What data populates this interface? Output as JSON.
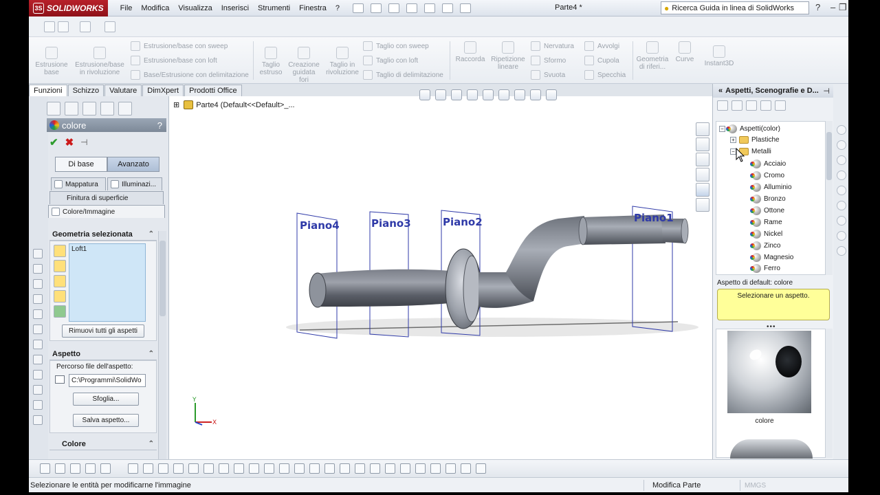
{
  "window": {
    "app_name": "SOLIDWORKS",
    "doc_title": "Parte4 *",
    "menu": [
      "File",
      "Modifica",
      "Visualizza",
      "Inserisci",
      "Strumenti",
      "Finestra",
      "?"
    ],
    "help_search_placeholder": "Ricerca Guida in linea di SolidWorks"
  },
  "ribbon": {
    "estrusione_base": "Estrusione\nbase",
    "rivoluzione_base": "Estrusione/base\nin rivoluzione",
    "sweep_base": "Estrusione/base con sweep",
    "loft_base": "Estrusione/base con loft",
    "delim_base": "Base/Estrusione con delimitazione",
    "taglio_estruso": "Taglio\nestruso",
    "creazione_guidata_fori": "Creazione\nguidata\nfori",
    "taglio_rivoluzione": "Taglio in\nrivoluzione",
    "taglio_sweep": "Taglio con sweep",
    "taglio_loft": "Taglio con loft",
    "taglio_delim": "Taglio di delimitazione",
    "raccorda": "Raccorda",
    "ripetizione_lineare": "Ripetizione\nlineare",
    "nervatura": "Nervatura",
    "sformo": "Sformo",
    "svuota": "Svuota",
    "avvolgi": "Avvolgi",
    "cupola": "Cupola",
    "specchia": "Specchia",
    "geometria_riferimento": "Geometria\ndi riferi...",
    "curve": "Curve",
    "instant3d": "Instant3D"
  },
  "cm_tabs": [
    "Funzioni",
    "Schizzo",
    "Valutare",
    "DimXpert",
    "Prodotti Office"
  ],
  "property_manager": {
    "title": "colore",
    "help": "?",
    "mode_tabs": [
      "Di base",
      "Avanzato"
    ],
    "subtabs": {
      "mappatura": "Mappatura",
      "illuminazione": "Illuminazi...",
      "finitura": "Finitura di superficie",
      "colore_immagine": "Colore/Immagine"
    },
    "geometria": {
      "header": "Geometria selezionata",
      "selected": [
        "Loft1"
      ],
      "remove_button": "Rimuovi tutti gli aspetti"
    },
    "aspetto": {
      "header": "Aspetto",
      "path_label": "Percorso file dell'aspetto:",
      "path_value": "C:\\Programmi\\SolidWo",
      "browse_button": "Sfoglia...",
      "save_button": "Salva aspetto..."
    },
    "colore_header": "Colore"
  },
  "graphics": {
    "tree_root": "Parte4  (Default<<Default>_...",
    "planes": [
      "Piano4",
      "Piano3",
      "Piano2",
      "Piano1"
    ],
    "triad": {
      "x": "X",
      "y": "Y"
    }
  },
  "task_pane": {
    "title": "Aspetti, Scenografie e D...",
    "tree": {
      "root": "Aspetti(color)",
      "plastiche": "Plastiche",
      "metalli": "Metalli",
      "metals": [
        "Acciaio",
        "Cromo",
        "Alluminio",
        "Bronzo",
        "Ottone",
        "Rame",
        "Nickel",
        "Zinco",
        "Magnesio",
        "Ferro"
      ]
    },
    "default_label": "Aspetto di default: colore",
    "hint": "Selezionare un aspetto.",
    "thumbnail_label": "colore"
  },
  "statusbar": {
    "message": "Selezionare le entità per modificarne l'immagine",
    "mode": "Modifica Parte",
    "units": "MMGS"
  }
}
